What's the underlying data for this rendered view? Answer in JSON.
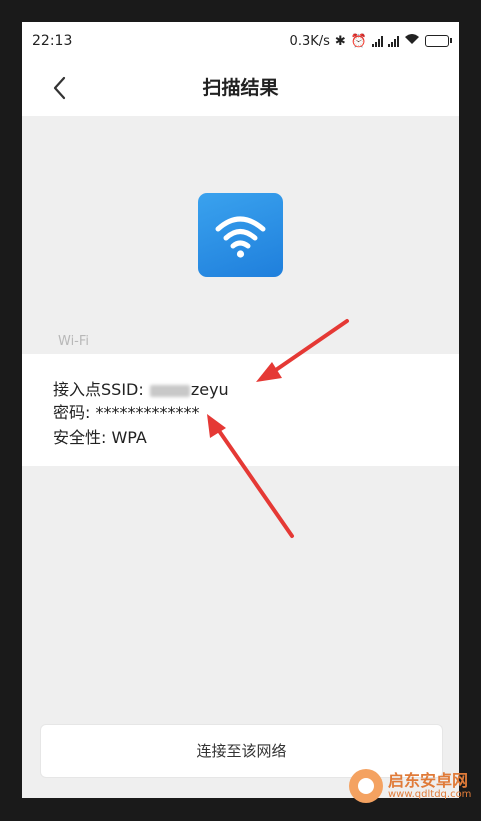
{
  "status_bar": {
    "time": "22:13",
    "net_speed": "0.3K/s",
    "icons": [
      "bluetooth-icon",
      "alarm-icon",
      "signal-icon",
      "signal-icon",
      "wifi-icon",
      "battery-icon"
    ]
  },
  "header": {
    "back_icon": "chevron-left-icon",
    "title": "扫描结果"
  },
  "wifi_icon": {
    "name": "wifi-icon",
    "color": "#2b8fe6"
  },
  "section": {
    "label": "Wi-Fi"
  },
  "details": {
    "ssid_label": "接入点SSID: ",
    "ssid_value": "zeyu",
    "password_label": "密码: ",
    "password_value": "*************",
    "security_label": "安全性: ",
    "security_value": "WPA"
  },
  "actions": {
    "connect_label": "连接至该网络"
  },
  "watermark": {
    "title": "启东安卓网",
    "url": "www.qdltdq.com"
  },
  "colors": {
    "accent": "#2b8fe6",
    "arrow": "#e53935"
  }
}
